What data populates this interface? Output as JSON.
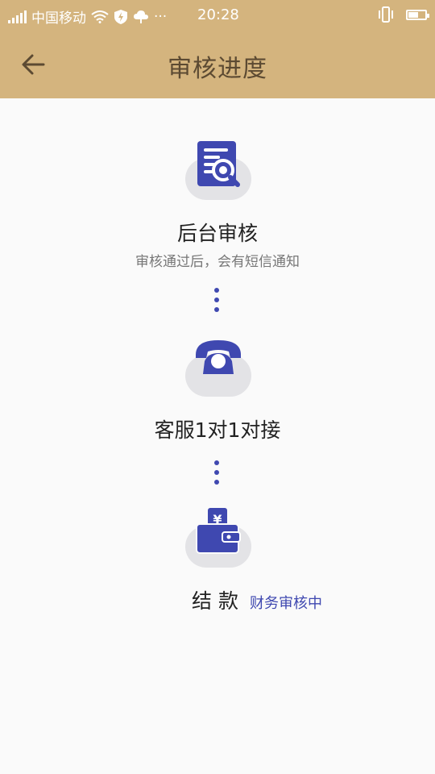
{
  "status_bar": {
    "carrier": "中国移动",
    "time": "20:28",
    "more": "···",
    "battery_level": 0.55
  },
  "nav": {
    "back_icon": "arrow-left-icon",
    "title": "审核进度"
  },
  "steps": [
    {
      "icon": "document-search-icon",
      "title": "后台审核",
      "subtitle": "审核通过后，会有短信通知"
    },
    {
      "icon": "telephone-icon",
      "title": "客服1对1对接"
    },
    {
      "icon": "wallet-icon",
      "title": "结款",
      "status": "财务审核中"
    }
  ],
  "colors": {
    "header_bg": "#d4b47e",
    "accent": "#3f48b0",
    "background": "#fafafa"
  }
}
